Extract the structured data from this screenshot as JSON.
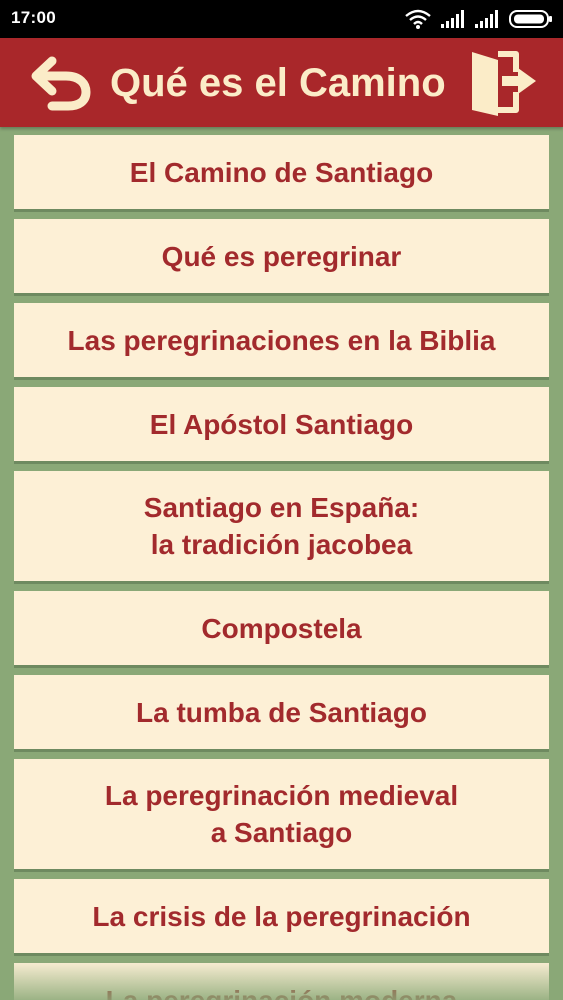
{
  "status_bar": {
    "time": "17:00"
  },
  "header": {
    "title": "Qué es el Camino",
    "back_icon": "back-arrow-icon",
    "exit_icon": "exit-door-icon"
  },
  "colors": {
    "header_bg": "#a9272a",
    "title_text": "#fbecc8",
    "list_bg": "#8aa877",
    "item_bg": "#fdf0d6",
    "item_text": "#a22a2d"
  },
  "menu": {
    "items": [
      {
        "label": "El Camino de Santiago"
      },
      {
        "label": "Qué es peregrinar"
      },
      {
        "label": "Las peregrinaciones en la Biblia"
      },
      {
        "label": "El Apóstol Santiago"
      },
      {
        "label": "Santiago en España:\n la tradición jacobea"
      },
      {
        "label": "Compostela"
      },
      {
        "label": "La tumba de Santiago"
      },
      {
        "label": "La peregrinación medieval\n a Santiago"
      },
      {
        "label": "La crisis de la peregrinación"
      },
      {
        "label": "La peregrinación moderna"
      }
    ]
  }
}
